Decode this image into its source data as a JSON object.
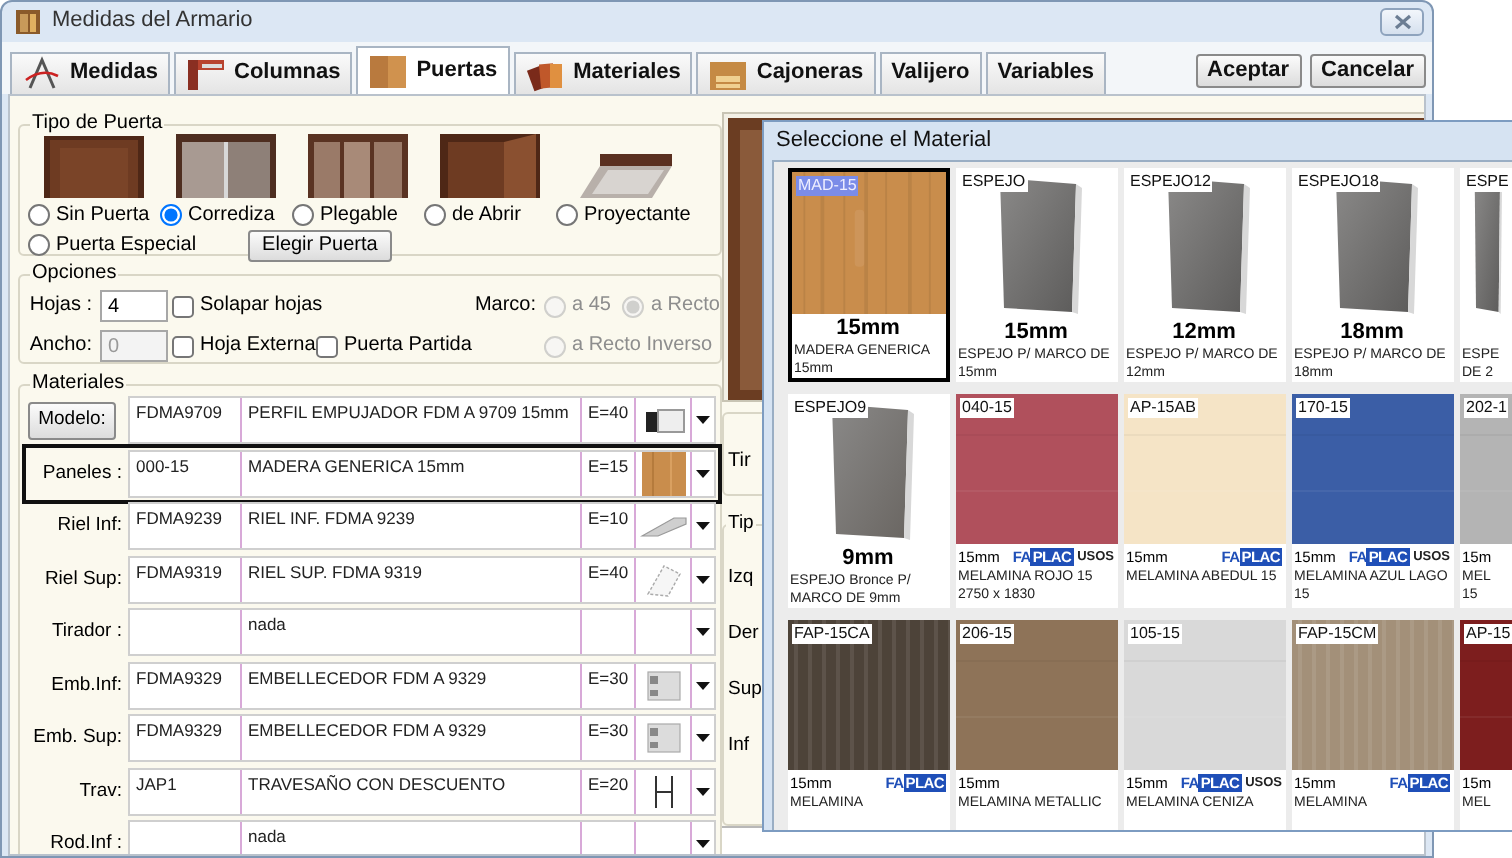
{
  "window": {
    "title": "Medidas del Armario"
  },
  "tabs": [
    {
      "label": "Medidas",
      "selected": false
    },
    {
      "label": "Columnas",
      "selected": false
    },
    {
      "label": "Puertas",
      "selected": true
    },
    {
      "label": "Materiales",
      "selected": false
    },
    {
      "label": "Cajoneras",
      "selected": false
    },
    {
      "label": "Valijero",
      "selected": false
    },
    {
      "label": "Variables",
      "selected": false
    }
  ],
  "buttons": [
    "Aceptar",
    "Cancelar"
  ],
  "door_type": {
    "title": "Tipo de Puerta",
    "button": "Elegir Puerta",
    "options": [
      {
        "label": "Sin Puerta",
        "selected": false,
        "kind": "picture"
      },
      {
        "label": "Corrediza",
        "selected": true,
        "kind": "picture"
      },
      {
        "label": "Plegable",
        "selected": false,
        "kind": "picture"
      },
      {
        "label": "de Abrir",
        "selected": false,
        "kind": "picture"
      },
      {
        "label": "Proyectante",
        "selected": false,
        "kind": "picture"
      },
      {
        "label": "Puerta Especial",
        "selected": false,
        "kind": "plain"
      }
    ]
  },
  "options": {
    "title": "Opciones",
    "leaves": {
      "label": "Hojas :",
      "value": "4"
    },
    "width": {
      "label": "Ancho:",
      "value": "0",
      "disabled": true
    },
    "checks": [
      {
        "label": "Solapar hojas",
        "checked": false
      },
      {
        "label": "Hoja Externa",
        "checked": false
      },
      {
        "label": "Puerta Partida",
        "checked": false
      }
    ],
    "frame": {
      "label": "Marco:",
      "options": [
        {
          "label": "a 45",
          "selected": false,
          "disabled": true
        },
        {
          "label": "a Recto",
          "selected": true,
          "disabled": true
        },
        {
          "label": "a Recto Inverso",
          "selected": false,
          "disabled": true
        }
      ]
    }
  },
  "materials": {
    "title": "Materiales",
    "rows": [
      {
        "label": "Modelo:",
        "kind": "button",
        "code": "FDMA9709",
        "description": "PERFIL EMPUJADOR FDM A 9709 15mm",
        "thickness": "E=40",
        "highlighted": false
      },
      {
        "label": "Paneles :",
        "kind": "text",
        "code": "000-15",
        "description": "MADERA GENERICA 15mm",
        "thickness": "E=15",
        "highlighted": true
      },
      {
        "label": "Riel Inf:",
        "kind": "text",
        "code": "FDMA9239",
        "description": "RIEL INF. FDMA 9239",
        "thickness": "E=10",
        "highlighted": false
      },
      {
        "label": "Riel Sup:",
        "kind": "text",
        "code": "FDMA9319",
        "description": "RIEL SUP. FDMA 9319",
        "thickness": "E=40",
        "highlighted": false
      },
      {
        "label": "Tirador :",
        "kind": "text",
        "description": "nada",
        "highlighted": false
      },
      {
        "label": "Emb.Inf:",
        "kind": "text",
        "code": "FDMA9329",
        "description": "EMBELLECEDOR FDM A 9329",
        "thickness": "E=30",
        "highlighted": false
      },
      {
        "label": "Emb. Sup:",
        "kind": "text",
        "code": "FDMA9329",
        "description": "EMBELLECEDOR FDM A 9329",
        "thickness": "E=30",
        "highlighted": false
      },
      {
        "label": "Trav:",
        "kind": "text",
        "code": "JAP1",
        "description": "TRAVESAÑO CON DESCUENTO",
        "thickness": "E=20",
        "highlighted": false
      },
      {
        "label": "Rod.Inf :",
        "kind": "text",
        "description": "nada",
        "highlighted": false
      }
    ]
  },
  "side_panel": {
    "labels": [
      "Tir",
      "Tip",
      "Izq",
      "Der",
      "Sup",
      "Inf"
    ]
  },
  "picker": {
    "title": "Seleccione el Material",
    "tiles": [
      {
        "code": "MAD-15",
        "kind": "wood",
        "color": "#c98d4c",
        "thickness": "15mm",
        "name": "MADERA GENERICA 15mm",
        "selected": true
      },
      {
        "code": "ESPEJO",
        "kind": "mirror",
        "color": "#5d5c5b",
        "thickness": "15mm",
        "name": "ESPEJO P/ MARCO DE 15mm",
        "selected": false
      },
      {
        "code": "ESPEJO12",
        "kind": "mirror",
        "color": "#5d5c5b",
        "thickness": "12mm",
        "name": "ESPEJO P/ MARCO DE 12mm",
        "selected": false
      },
      {
        "code": "ESPEJO18",
        "kind": "mirror",
        "color": "#5d5c5b",
        "thickness": "18mm",
        "name": "ESPEJO P/ MARCO DE 18mm",
        "selected": false
      },
      {
        "code": "ESPE",
        "kind": "mirror",
        "color": "#5d5c5b",
        "name": "ESPE DE 2",
        "selected": false
      },
      {
        "code": "ESPEJO9",
        "kind": "mirror",
        "color": "#6a6662",
        "thickness": "9mm",
        "name": "ESPEJO Bronce P/ MARCO DE 9mm",
        "selected": false
      },
      {
        "code": "040-15",
        "kind": "solid",
        "color": "#b0505c",
        "thickness": "15mm",
        "brand": [
          "FA",
          "PLAC"
        ],
        "usage": "USOS",
        "name": "MELAMINA ROJO 15 2750 x 1830",
        "selected": false
      },
      {
        "code": "AP-15AB",
        "kind": "solid",
        "color": "#f5e4c6",
        "thickness": "15mm",
        "brand": [
          "FA",
          "PLAC"
        ],
        "name": "MELAMINA ABEDUL 15",
        "selected": false
      },
      {
        "code": "170-15",
        "kind": "solid",
        "color": "#3b5ea6",
        "thickness": "15mm",
        "brand": [
          "FA",
          "PLAC"
        ],
        "usage": "USOS",
        "name": "MELAMINA AZUL LAGO 15",
        "selected": false
      },
      {
        "code": "202-1",
        "kind": "solid",
        "color": "#b4b4b4",
        "thickness": "15m",
        "name": "MEL 15",
        "selected": false
      },
      {
        "code": "FAP-15CA",
        "kind": "grain",
        "color": "#4d4339",
        "thickness": "15mm",
        "brand": [
          "FA",
          "PLAC"
        ],
        "name": "MELAMINA",
        "selected": false
      },
      {
        "code": "206-15",
        "kind": "solid",
        "color": "#8e7358",
        "thickness": "15mm",
        "name": "MELAMINA METALLIC",
        "selected": false
      },
      {
        "code": "105-15",
        "kind": "solid",
        "color": "#d9d9d9",
        "thickness": "15mm",
        "brand": [
          "FA",
          "PLAC"
        ],
        "usage": "USOS",
        "name": "MELAMINA CENIZA",
        "selected": false
      },
      {
        "code": "FAP-15CM",
        "kind": "grain",
        "color": "#a39079",
        "thickness": "15mm",
        "brand": [
          "FA",
          "PLAC"
        ],
        "name": "MELAMINA",
        "selected": false
      },
      {
        "code": "AP-15",
        "kind": "solid",
        "color": "#7d1e1e",
        "thickness": "15m",
        "name": "MEL",
        "selected": false
      }
    ]
  }
}
